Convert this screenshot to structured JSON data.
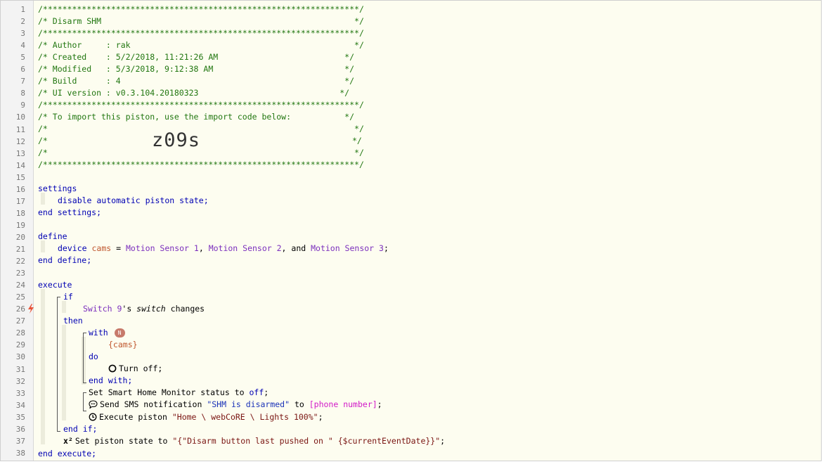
{
  "editor": {
    "line_numbers": [
      "1",
      "2",
      "3",
      "4",
      "5",
      "6",
      "7",
      "8",
      "9",
      "10",
      "11",
      "12",
      "13",
      "14",
      "15",
      "16",
      "17",
      "18",
      "19",
      "20",
      "21",
      "22",
      "23",
      "24",
      "25",
      "26",
      "27",
      "28",
      "29",
      "30",
      "31",
      "32",
      "33",
      "34",
      "35",
      "36",
      "37",
      "38"
    ],
    "header": {
      "stars": "/*****************************************************************/",
      "title": "/* Disarm SHM                                                    */",
      "author": "/* Author     : rak                                              */",
      "created": "/* Created    : 5/2/2018, 11:21:26 AM                          */",
      "modified": "/* Modified   : 5/3/2018, 9:12:38 AM                           */",
      "build": "/* Build      : 4                                              */",
      "ui_version": "/* UI version : v0.3.104.20180323                             */",
      "import_note": "/* To import this piston, use the import code below:           */",
      "blank": "/*                                                               */",
      "code_prefix": "/*",
      "code_suffix": "*/",
      "import_code": "z09s"
    },
    "settings": {
      "open": "settings",
      "line": "disable automatic piston state;",
      "close": "end settings;"
    },
    "define": {
      "open": "define",
      "kw_device": "device",
      "var_name": "cams",
      "equals": " = ",
      "device1": "Motion Sensor 1",
      "sep1": ", ",
      "device2": "Motion Sensor 2",
      "sep2": ", and ",
      "device3": "Motion Sensor 3",
      "semi": ";",
      "close": "end define;"
    },
    "execute": {
      "open": "execute",
      "if": "if",
      "cond_device": "Switch 9",
      "cond_possessive": "'s ",
      "cond_attr": "switch",
      "cond_op": " changes",
      "then": "then",
      "with": "with",
      "with_badge": "N",
      "with_target": "{cams}",
      "do": "do",
      "turn_off": "Turn off;",
      "end_with": "end with;",
      "shm_prefix": "Set Smart Home Monitor status to ",
      "shm_value": "off",
      "shm_suffix": ";",
      "sms_prefix": "Send SMS notification ",
      "sms_message": "\"SHM is disarmed\"",
      "sms_to": " to ",
      "sms_target": "[phone number]",
      "sms_suffix": ";",
      "exec_prefix": "Execute piston ",
      "exec_target": "\"Home \\ webCoRE \\ Lights 100%\"",
      "exec_suffix": ";",
      "end_if": "end if;",
      "state_prefix": "Set piston state to ",
      "state_value": "\"{\"Disarm button last pushed on \" {$currentEventDate}}\"",
      "state_suffix": ";",
      "close": "end execute;"
    }
  },
  "colors": {
    "comment": "#227711",
    "keyword": "#0000b3",
    "device": "#7b2fbd",
    "variable": "#c0572e",
    "string": "#1b33b8",
    "literal": "#7a1512",
    "argument": "#d21ac8",
    "trigger_bolt": "#e8553a"
  },
  "icons": [
    "lightning-bolt-icon",
    "power-icon",
    "sms-icon",
    "execute-piston-icon",
    "superscript-x2-icon"
  ]
}
